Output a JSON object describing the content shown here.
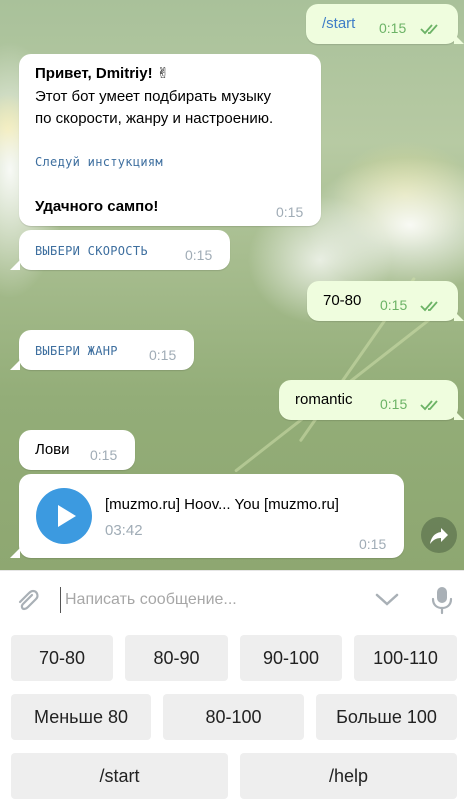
{
  "messages": {
    "start": {
      "text": "/start",
      "time": "0:15"
    },
    "welcome": {
      "greeting": "Привет, Dmitriy! ✌",
      "line1": "Этот бот умеет подбирать музыку",
      "line2": "по скорости, жанру и настроению.",
      "instruction": "Следуй инстукциям",
      "luck": "Удачного сампо!",
      "time": "0:15"
    },
    "choose_speed": {
      "text": "ВЫБЕРИ СКОРОСТЬ",
      "time": "0:15"
    },
    "speed_reply": {
      "text": "70-80",
      "time": "0:15"
    },
    "choose_genre": {
      "text": "ВЫБЕРИ ЖАНР",
      "time": "0:15"
    },
    "genre_reply": {
      "text": "romantic",
      "time": "0:15"
    },
    "catch": {
      "text": "Лови",
      "time": "0:15"
    },
    "audio": {
      "title": "[muzmo.ru] Hoov... You [muzmo.ru]",
      "duration": "03:42",
      "time": "0:15"
    }
  },
  "input": {
    "placeholder": "Написать сообщение..."
  },
  "keyboard": {
    "row1": [
      "70-80",
      "80-90",
      "90-100",
      "100-110"
    ],
    "row2": [
      "Меньше 80",
      "80-100",
      "Больше 100"
    ],
    "row3": [
      "/start",
      "/help"
    ]
  },
  "colors": {
    "accent": "#3c9ae0",
    "outgoing_bubble": "#effdde",
    "read_check": "#6cb366"
  }
}
